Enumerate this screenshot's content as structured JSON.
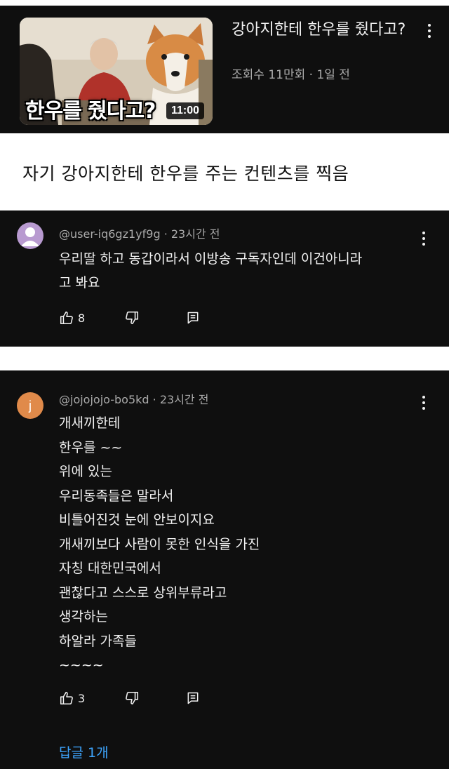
{
  "video": {
    "thumbnail_text": "한우를 줬다고?",
    "duration": "11:00",
    "title": "강아지한테 한우를 줬다고?",
    "meta": "조회수 11만회 · 1일 전",
    "menu_icon": "more-vert-icon"
  },
  "post_caption": "자기 강아지한테 한우를 주는 컨텐츠를 찍음",
  "comments": [
    {
      "author": "@user-iq6gz1yf9g",
      "time": "23시간 전",
      "lines": [
        "우리딸 하고 동갑이라서 이방송 구독자인데 이건아니라",
        "고 봐요"
      ],
      "likes": "8",
      "avatar_letter": ""
    },
    {
      "author": "@jojojojo-bo5kd",
      "time": "23시간 전",
      "lines": [
        "개새끼한테",
        "한우를 ~~",
        "위에 있는",
        "우리동족들은 말라서",
        "비틀어진것 눈에 안보이지요",
        "개새끼보다 사람이 못한 인식을 가진",
        "자칭 대한민국에서",
        "괜찮다고 스스로 상위부류라고",
        "생각하는",
        "하알라 가족들",
        "~~~~"
      ],
      "likes": "3",
      "avatar_letter": "j",
      "reply_link": "답글 1개"
    }
  ],
  "colors": {
    "card_bg": "#0f0f0f",
    "text": "#f1f1f1",
    "secondary_text": "#aaaaaa",
    "link": "#3ea6ff",
    "avatar1": "#b89ad0",
    "avatar2": "#e08a4a"
  }
}
